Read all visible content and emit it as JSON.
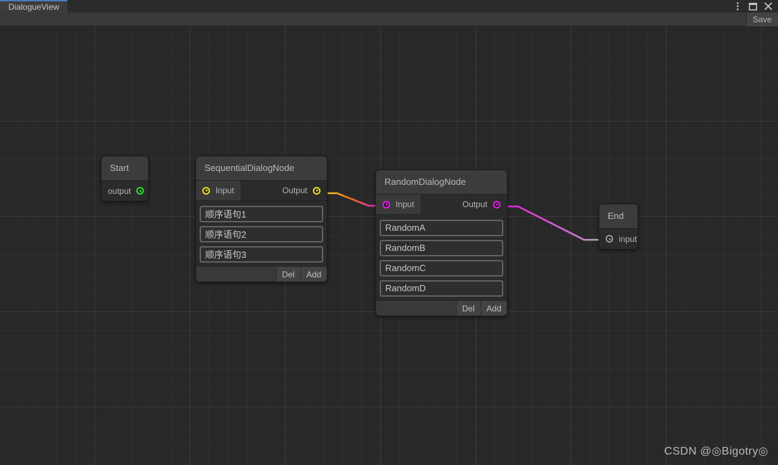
{
  "window": {
    "tab_label": "DialogueView",
    "controls": [
      {
        "name": "more-menu-icon",
        "glyph": "kebab"
      },
      {
        "name": "maximize-icon",
        "glyph": "square"
      },
      {
        "name": "close-icon",
        "glyph": "cross"
      }
    ],
    "toolbar": {
      "save_label": "Save"
    }
  },
  "graph": {
    "nodes": {
      "start": {
        "title": "Start",
        "output_label": "output",
        "port_color": "#2ee02e"
      },
      "sequential": {
        "title": "SequentialDialogNode",
        "input_label": "Input",
        "output_label": "Output",
        "port_color": "#ecdf2a",
        "fields": [
          "顺序语句1",
          "顺序语句2",
          "顺序语句3"
        ],
        "footer": {
          "del_label": "Del",
          "add_label": "Add",
          "input_value": ""
        }
      },
      "random": {
        "title": "RandomDialogNode",
        "input_label": "Input",
        "output_label": "Output",
        "port_color": "#e01ce0",
        "fields": [
          "RandomA",
          "RandomB",
          "RandomC",
          "RandomD"
        ],
        "footer": {
          "del_label": "Del",
          "add_label": "Add",
          "input_value": ""
        }
      },
      "end": {
        "title": "End",
        "input_label": "input",
        "port_color": "#9a9a9a"
      }
    },
    "edges": [
      {
        "from": "start.output",
        "to": "sequential.input",
        "color_start": "#2ee02e",
        "color_end": "#ecdf2a"
      },
      {
        "from": "sequential.output",
        "to": "random.input",
        "color_start": "#ecdf2a",
        "color_end": "#e01ce0"
      },
      {
        "from": "random.output",
        "to": "end.input",
        "color_start": "#e01ce0",
        "color_end": "#9a9a9a"
      }
    ]
  },
  "watermark": {
    "text": "CSDN @◎Bigotry◎"
  }
}
